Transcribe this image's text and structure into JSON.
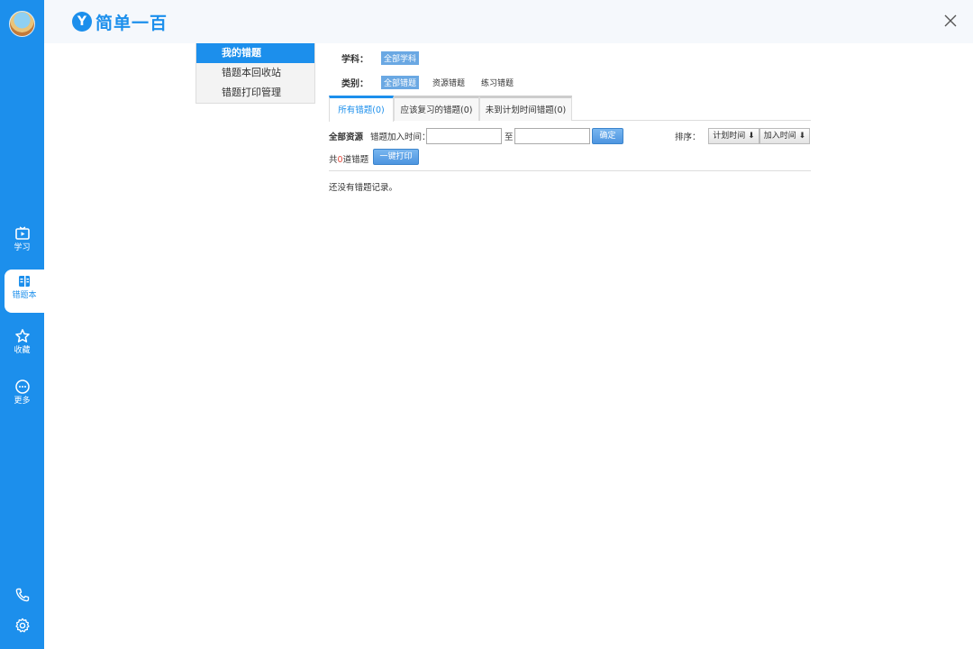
{
  "app": {
    "brand_badge": "Y",
    "brand_name": "简单一百"
  },
  "rail": {
    "items": [
      {
        "label": "学习"
      },
      {
        "label": "错题本"
      },
      {
        "label": "收藏"
      },
      {
        "label": "更多"
      }
    ]
  },
  "submenu": {
    "items": [
      {
        "label": "我的错题"
      },
      {
        "label": "错题本回收站"
      },
      {
        "label": "错题打印管理"
      }
    ]
  },
  "filters": {
    "subject": {
      "label": "学科：",
      "options": [
        "全部学科"
      ]
    },
    "category": {
      "label": "类别：",
      "options": [
        "全部错题",
        "资源错题",
        "练习错题"
      ]
    }
  },
  "tabs": [
    "所有错题(0)",
    "应该复习的错题(0)",
    "未到计划时间错题(0)"
  ],
  "toolbar": {
    "all_label": "全部资源",
    "time_label": "错题加入时间：",
    "to_label": "至",
    "confirm_label": "确定",
    "sort_label": "排序：",
    "sort_plan_label": "计划时间 ⬇",
    "sort_add_label": "加入时间 ⬇"
  },
  "count": {
    "prefix": "共",
    "value": "0",
    "suffix": "道错题",
    "print_label": "一键打印"
  },
  "empty_text": "还没有错题记录。"
}
